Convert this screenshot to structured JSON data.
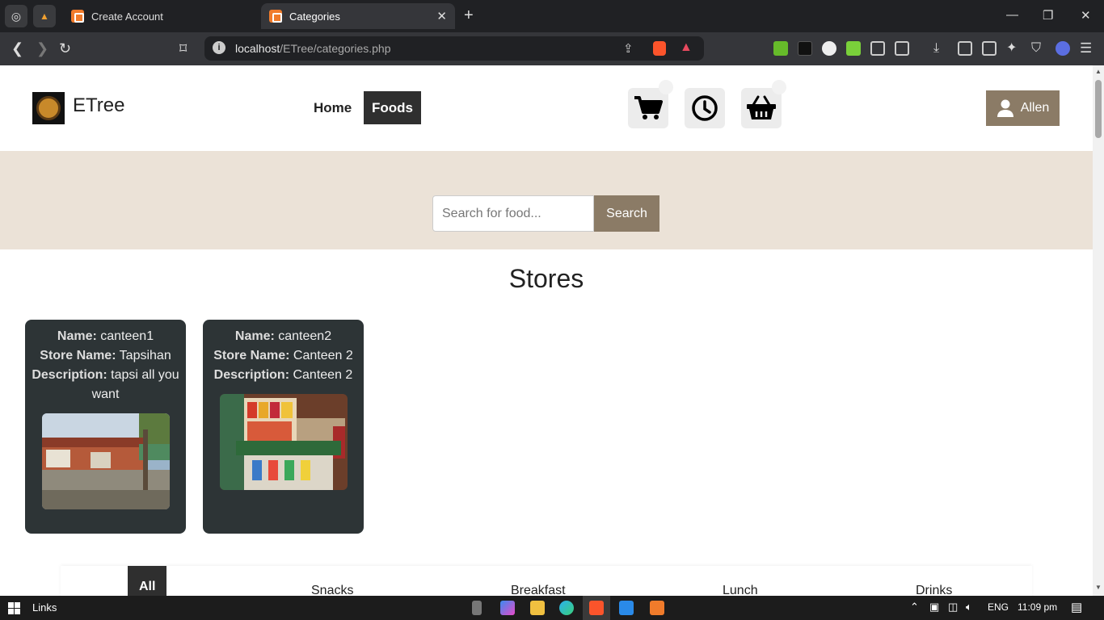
{
  "browser": {
    "tabs": [
      {
        "title": "Create Account"
      },
      {
        "title": "Categories"
      }
    ],
    "url_host": "localhost",
    "url_path": "/ETree/categories.php"
  },
  "header": {
    "brand": "ETree",
    "nav": [
      "Home",
      "Foods"
    ],
    "user": "Allen"
  },
  "search": {
    "placeholder": "Search for food...",
    "button": "Search"
  },
  "stores": {
    "title": "Stores",
    "labels": {
      "name": "Name:",
      "store_name": "Store Name:",
      "description": "Description:"
    },
    "items": [
      {
        "name": "canteen1",
        "store_name": "Tapsihan",
        "description": "tapsi all you want"
      },
      {
        "name": "canteen2",
        "store_name": "Canteen 2",
        "description": "Canteen 2"
      }
    ]
  },
  "categories": [
    "All",
    "Snacks",
    "Breakfast",
    "Lunch",
    "Drinks"
  ],
  "taskbar": {
    "links": "Links",
    "lang": "ENG",
    "time": "11:09 pm"
  },
  "colors": {
    "accent": "#8b7b66",
    "hero_bg": "#ebe2d7",
    "card_bg": "#2d3436",
    "nav_active": "#2f2f2f"
  }
}
